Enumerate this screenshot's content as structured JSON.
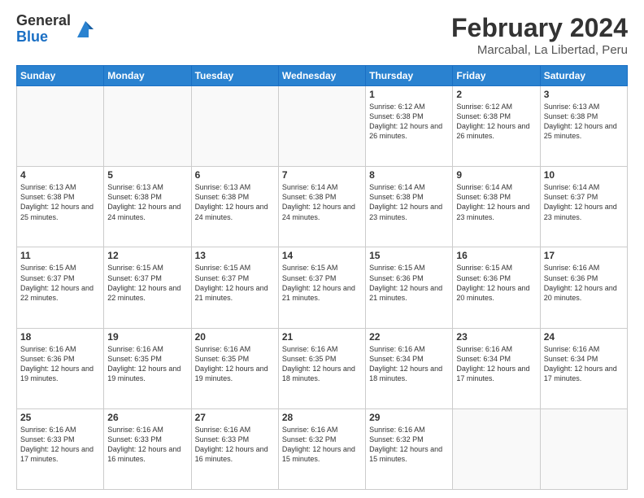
{
  "logo": {
    "general": "General",
    "blue": "Blue"
  },
  "header": {
    "title": "February 2024",
    "subtitle": "Marcabal, La Libertad, Peru"
  },
  "days_of_week": [
    "Sunday",
    "Monday",
    "Tuesday",
    "Wednesday",
    "Thursday",
    "Friday",
    "Saturday"
  ],
  "weeks": [
    [
      {
        "day": "",
        "info": ""
      },
      {
        "day": "",
        "info": ""
      },
      {
        "day": "",
        "info": ""
      },
      {
        "day": "",
        "info": ""
      },
      {
        "day": "1",
        "info": "Sunrise: 6:12 AM\nSunset: 6:38 PM\nDaylight: 12 hours and 26 minutes."
      },
      {
        "day": "2",
        "info": "Sunrise: 6:12 AM\nSunset: 6:38 PM\nDaylight: 12 hours and 26 minutes."
      },
      {
        "day": "3",
        "info": "Sunrise: 6:13 AM\nSunset: 6:38 PM\nDaylight: 12 hours and 25 minutes."
      }
    ],
    [
      {
        "day": "4",
        "info": "Sunrise: 6:13 AM\nSunset: 6:38 PM\nDaylight: 12 hours and 25 minutes."
      },
      {
        "day": "5",
        "info": "Sunrise: 6:13 AM\nSunset: 6:38 PM\nDaylight: 12 hours and 24 minutes."
      },
      {
        "day": "6",
        "info": "Sunrise: 6:13 AM\nSunset: 6:38 PM\nDaylight: 12 hours and 24 minutes."
      },
      {
        "day": "7",
        "info": "Sunrise: 6:14 AM\nSunset: 6:38 PM\nDaylight: 12 hours and 24 minutes."
      },
      {
        "day": "8",
        "info": "Sunrise: 6:14 AM\nSunset: 6:38 PM\nDaylight: 12 hours and 23 minutes."
      },
      {
        "day": "9",
        "info": "Sunrise: 6:14 AM\nSunset: 6:38 PM\nDaylight: 12 hours and 23 minutes."
      },
      {
        "day": "10",
        "info": "Sunrise: 6:14 AM\nSunset: 6:37 PM\nDaylight: 12 hours and 23 minutes."
      }
    ],
    [
      {
        "day": "11",
        "info": "Sunrise: 6:15 AM\nSunset: 6:37 PM\nDaylight: 12 hours and 22 minutes."
      },
      {
        "day": "12",
        "info": "Sunrise: 6:15 AM\nSunset: 6:37 PM\nDaylight: 12 hours and 22 minutes."
      },
      {
        "day": "13",
        "info": "Sunrise: 6:15 AM\nSunset: 6:37 PM\nDaylight: 12 hours and 21 minutes."
      },
      {
        "day": "14",
        "info": "Sunrise: 6:15 AM\nSunset: 6:37 PM\nDaylight: 12 hours and 21 minutes."
      },
      {
        "day": "15",
        "info": "Sunrise: 6:15 AM\nSunset: 6:36 PM\nDaylight: 12 hours and 21 minutes."
      },
      {
        "day": "16",
        "info": "Sunrise: 6:15 AM\nSunset: 6:36 PM\nDaylight: 12 hours and 20 minutes."
      },
      {
        "day": "17",
        "info": "Sunrise: 6:16 AM\nSunset: 6:36 PM\nDaylight: 12 hours and 20 minutes."
      }
    ],
    [
      {
        "day": "18",
        "info": "Sunrise: 6:16 AM\nSunset: 6:36 PM\nDaylight: 12 hours and 19 minutes."
      },
      {
        "day": "19",
        "info": "Sunrise: 6:16 AM\nSunset: 6:35 PM\nDaylight: 12 hours and 19 minutes."
      },
      {
        "day": "20",
        "info": "Sunrise: 6:16 AM\nSunset: 6:35 PM\nDaylight: 12 hours and 19 minutes."
      },
      {
        "day": "21",
        "info": "Sunrise: 6:16 AM\nSunset: 6:35 PM\nDaylight: 12 hours and 18 minutes."
      },
      {
        "day": "22",
        "info": "Sunrise: 6:16 AM\nSunset: 6:34 PM\nDaylight: 12 hours and 18 minutes."
      },
      {
        "day": "23",
        "info": "Sunrise: 6:16 AM\nSunset: 6:34 PM\nDaylight: 12 hours and 17 minutes."
      },
      {
        "day": "24",
        "info": "Sunrise: 6:16 AM\nSunset: 6:34 PM\nDaylight: 12 hours and 17 minutes."
      }
    ],
    [
      {
        "day": "25",
        "info": "Sunrise: 6:16 AM\nSunset: 6:33 PM\nDaylight: 12 hours and 17 minutes."
      },
      {
        "day": "26",
        "info": "Sunrise: 6:16 AM\nSunset: 6:33 PM\nDaylight: 12 hours and 16 minutes."
      },
      {
        "day": "27",
        "info": "Sunrise: 6:16 AM\nSunset: 6:33 PM\nDaylight: 12 hours and 16 minutes."
      },
      {
        "day": "28",
        "info": "Sunrise: 6:16 AM\nSunset: 6:32 PM\nDaylight: 12 hours and 15 minutes."
      },
      {
        "day": "29",
        "info": "Sunrise: 6:16 AM\nSunset: 6:32 PM\nDaylight: 12 hours and 15 minutes."
      },
      {
        "day": "",
        "info": ""
      },
      {
        "day": "",
        "info": ""
      }
    ]
  ]
}
